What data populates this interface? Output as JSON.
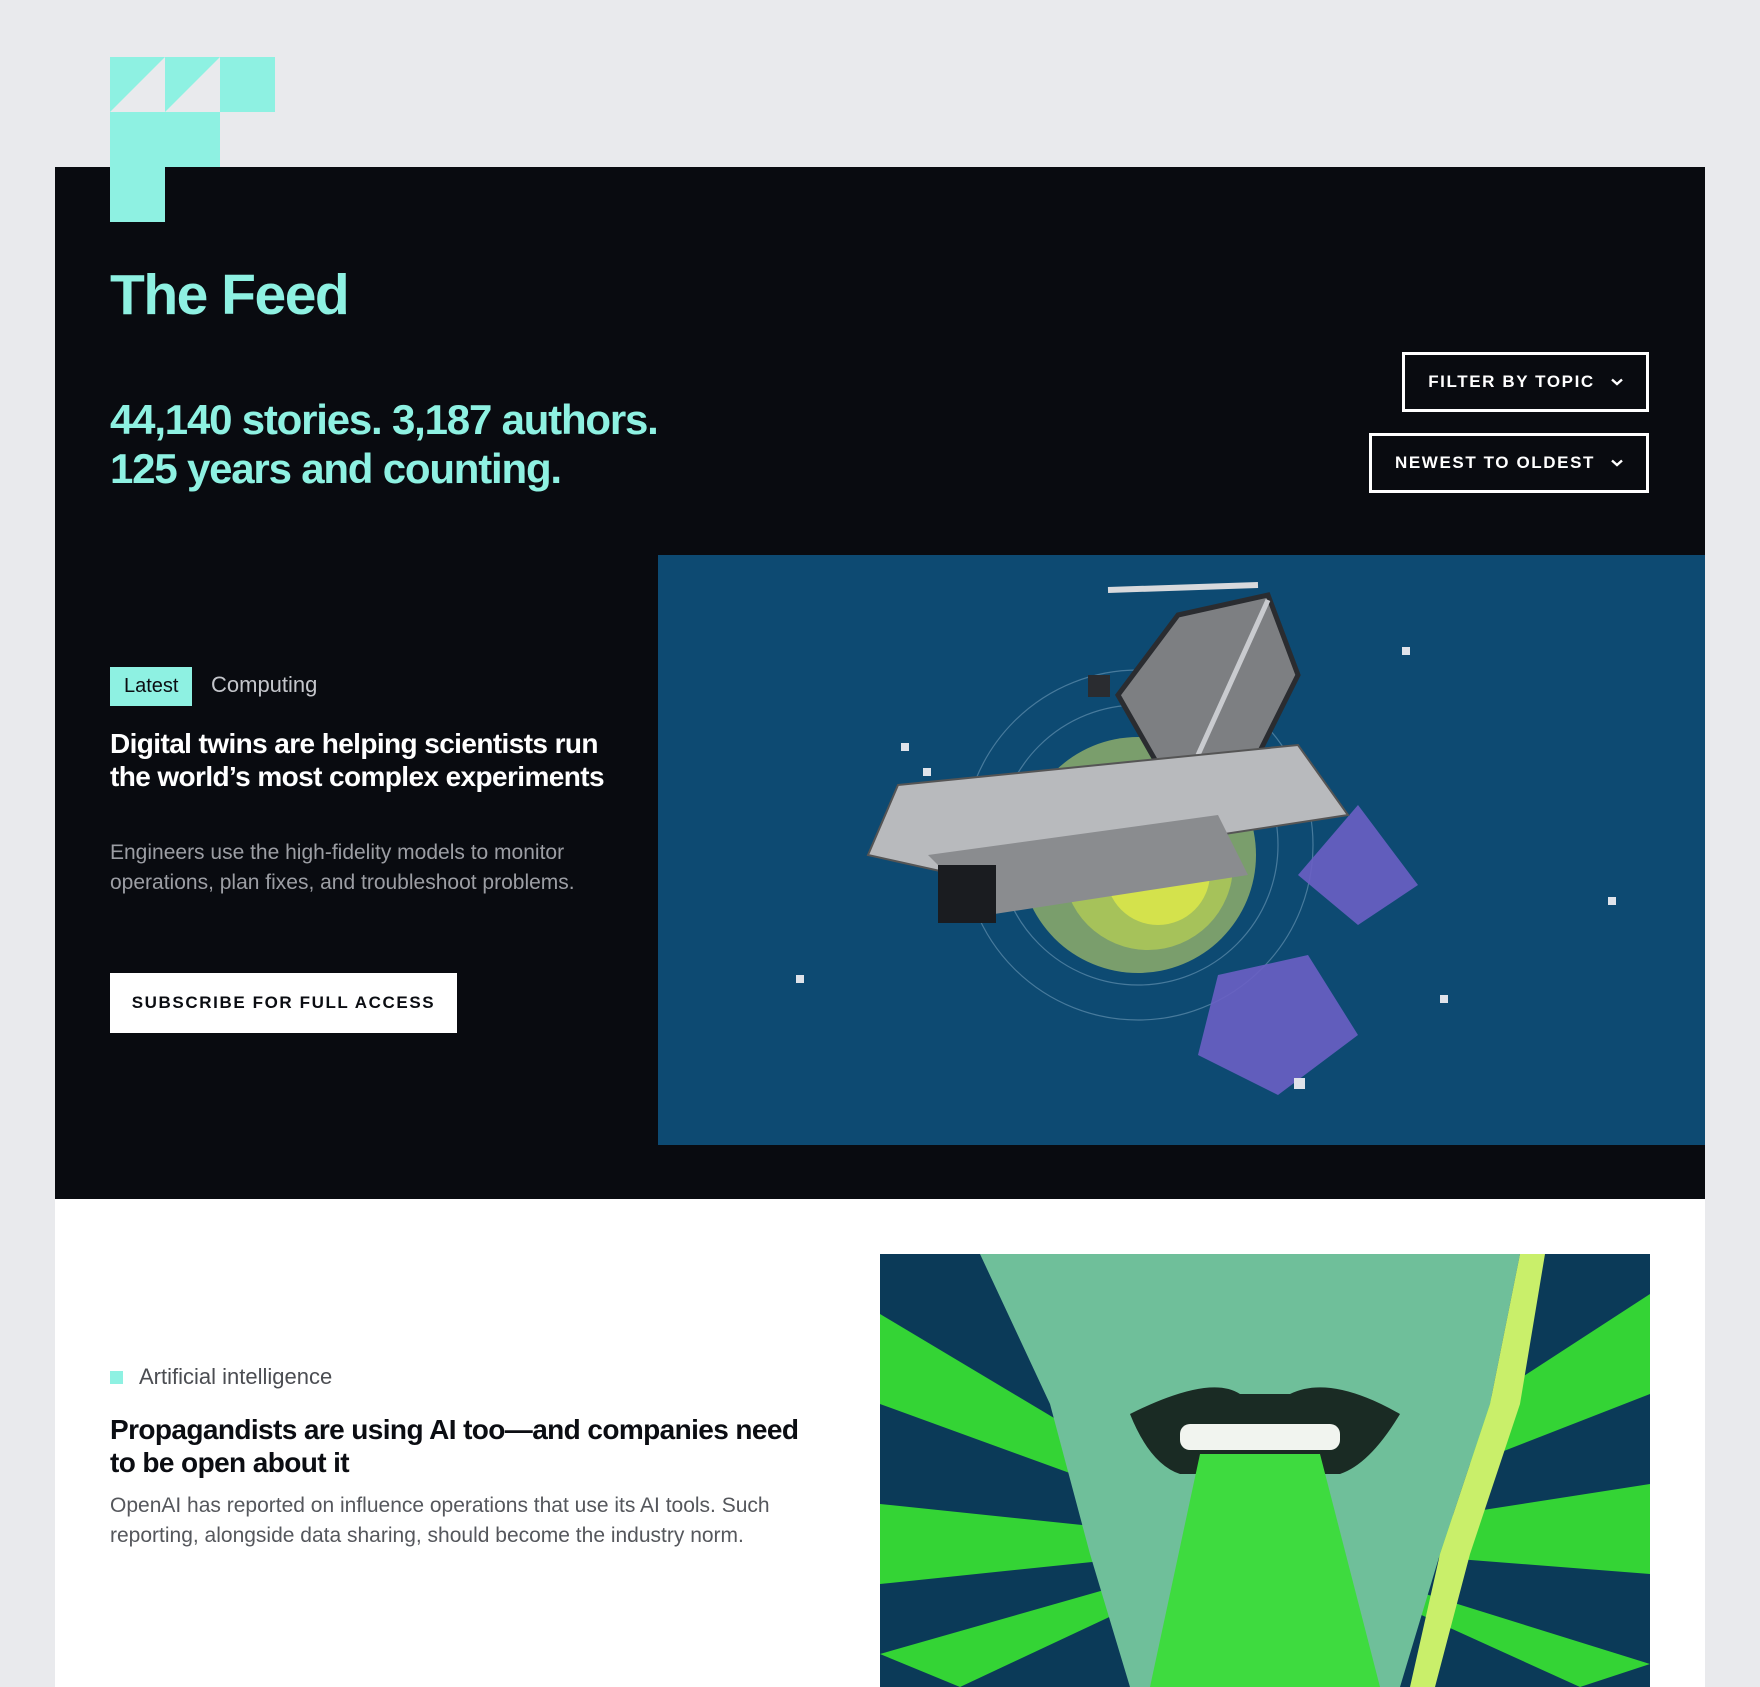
{
  "header": {
    "title": "The Feed",
    "stats_line1": "44,140 stories. 3,187 authors.",
    "stats_line2": "125 years and counting."
  },
  "controls": {
    "filter_label": "FILTER BY TOPIC",
    "sort_label": "NEWEST TO OLDEST"
  },
  "featured": {
    "badge": "Latest",
    "topic": "Computing",
    "headline": "Digital twins are helping scientists run the world’s most complex experiments",
    "dek": "Engineers use the high-fidelity models to monitor operations, plan fixes, and troubleshoot problems.",
    "cta": "SUBSCRIBE FOR FULL ACCESS",
    "image_subject": "james-webb-telescope-illustration"
  },
  "stories": [
    {
      "topic": "Artificial intelligence",
      "headline": "Propagandists are using AI too—and companies need to be open about it",
      "dek": "OpenAI has reported on influence operations that use its AI tools. Such reporting, alongside data sharing, should become the industry norm.",
      "image_subject": "shouting-face-illustration"
    }
  ],
  "colors": {
    "page_bg": "#e9eaed",
    "hero_bg": "#090b10",
    "accent": "#8ef1e2",
    "hero_image_bg": "#0d4a72",
    "story_image_green": "#34d435"
  }
}
